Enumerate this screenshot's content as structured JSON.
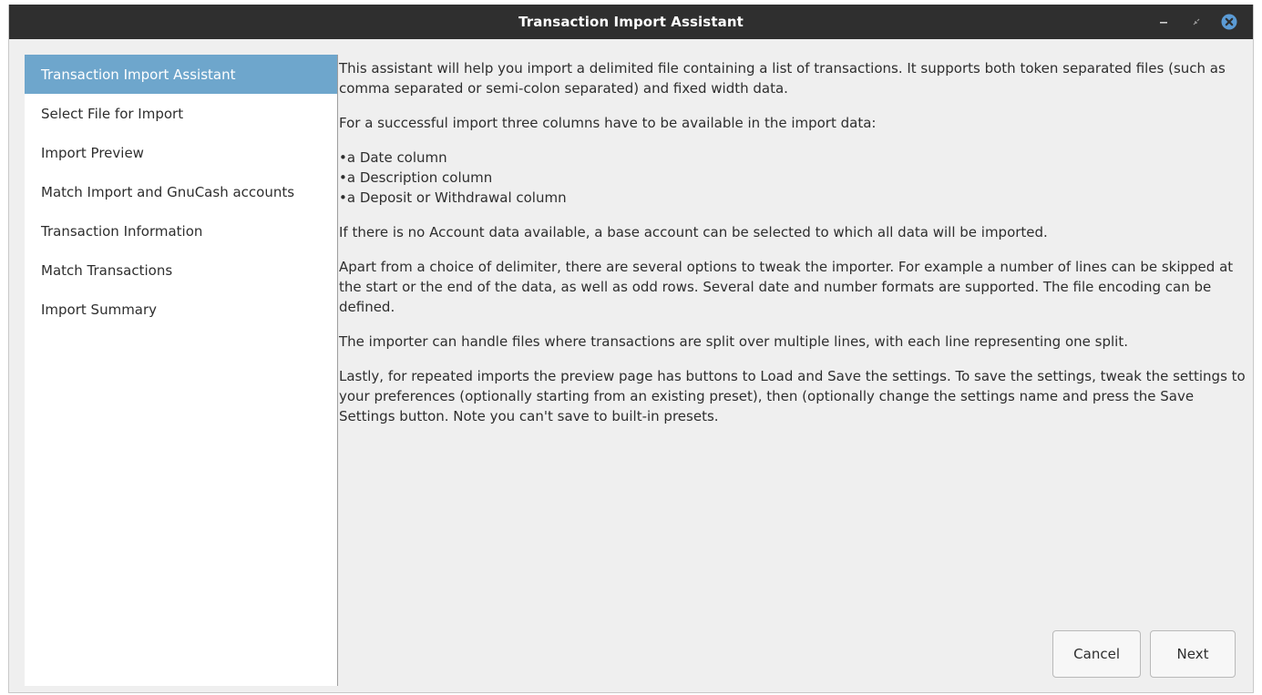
{
  "window": {
    "title": "Transaction Import Assistant",
    "controls": [
      "minimize-icon",
      "restore-icon",
      "close-icon"
    ],
    "close_color": "#5b9bd5"
  },
  "sidebar": {
    "active_index": 0,
    "items": [
      {
        "label": "Transaction Import Assistant"
      },
      {
        "label": "Select File for Import"
      },
      {
        "label": "Import Preview"
      },
      {
        "label": "Match Import and GnuCash accounts"
      },
      {
        "label": "Transaction Information"
      },
      {
        "label": "Match Transactions"
      },
      {
        "label": "Import Summary"
      }
    ],
    "active_color": "#6ea6cc"
  },
  "content": {
    "intro": "This assistant will help you import a delimited file containing a list of transactions. It supports both token separated files (such as comma separated or semi-colon separated) and fixed width data.",
    "requirements_heading": "For a successful import three columns have to be available in the import data:",
    "requirements": [
      "a Date column",
      "a Description column",
      "a Deposit or Withdrawal column"
    ],
    "account_note": "If there is no Account data available, a base account can be selected to which all data will be imported.",
    "options_note": "Apart from a choice of delimiter, there are several options to tweak the importer. For example a number of lines can be skipped at the start or the end of the data, as well as odd rows. Several date and number formats are supported. The file encoding can be defined.",
    "split_note": "The importer can handle files where transactions are split over multiple lines, with each line representing one split.",
    "settings_note": "Lastly, for repeated imports the preview page has buttons to Load and Save the settings. To save the settings, tweak the settings to your preferences (optionally starting from an existing preset), then (optionally change the settings name and press the Save Settings button. Note you can't save to built-in presets."
  },
  "buttons": {
    "cancel": "Cancel",
    "next": "Next"
  }
}
